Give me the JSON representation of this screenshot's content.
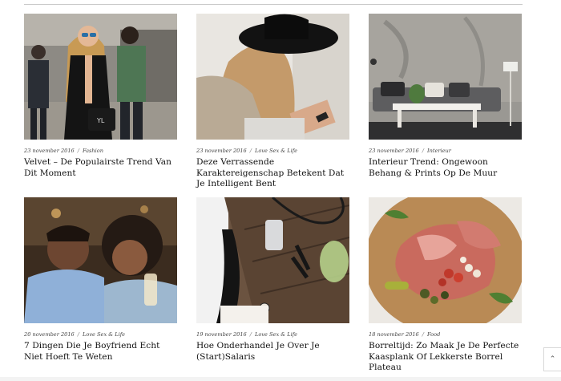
{
  "articles": [
    {
      "date": "23 november 2016",
      "category": "Fashion",
      "title": "Velvet – De Populairste Trend Van Dit Moment",
      "image": "street-style-photo"
    },
    {
      "date": "23 november 2016",
      "category": "Love Sex & Life",
      "title": "Deze Verrassende Karaktereigenschap Betekent Dat Je Intelligent Bent",
      "image": "woman-hat-phone-photo"
    },
    {
      "date": "23 november 2016",
      "category": "Interieur",
      "title": "Interieur Trend: Ongewoon Behang & Prints Op De Muur",
      "image": "living-room-photo"
    },
    {
      "date": "20 november 2016",
      "category": "Love Sex & Life",
      "title": "7 Dingen Die Je Boyfriend Echt Niet Hoeft Te Weten",
      "image": "couple-laughing-photo"
    },
    {
      "date": "19 november 2016",
      "category": "Love Sex & Life",
      "title": "Hoe Onderhandel Je Over Je (Start)Salaris",
      "image": "desk-flatlay-photo"
    },
    {
      "date": "18 november 2016",
      "category": "Food",
      "title": "Borreltijd: Zo Maak Je De Perfecte Kaasplank Of Lekkerste Borrel Plateau",
      "image": "charcuterie-board-photo"
    }
  ],
  "date_separator": "/",
  "scroll_top_icon": "chevron-up-icon",
  "colors": {
    "text": "#111111",
    "meta": "#444444",
    "rule": "#c9c9c9"
  }
}
